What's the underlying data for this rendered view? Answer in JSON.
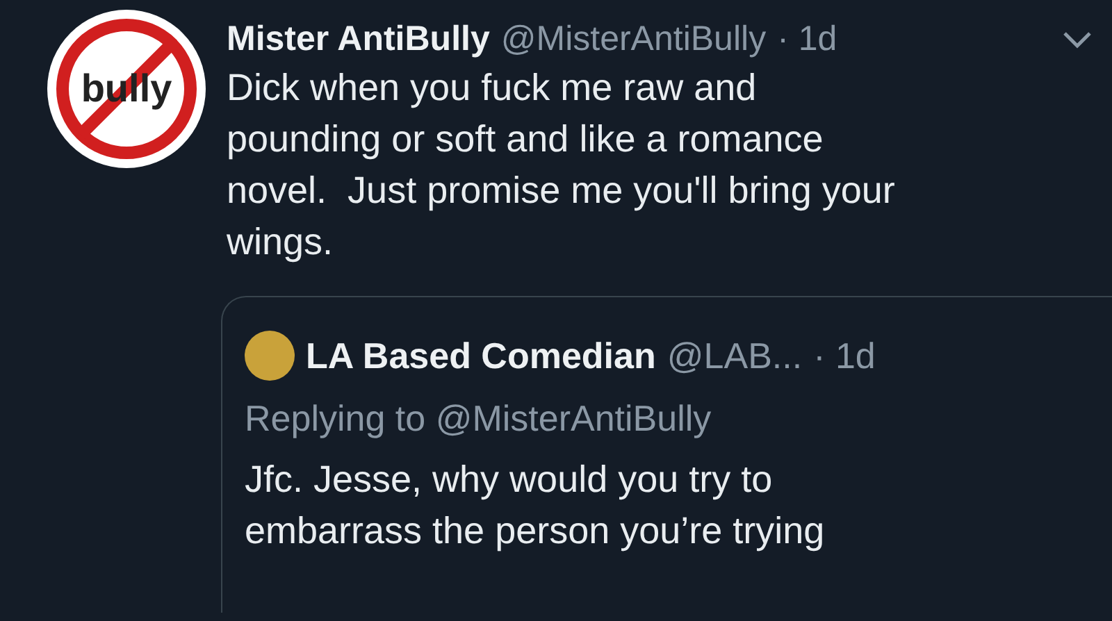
{
  "tweet": {
    "avatar_text": "bully",
    "name": "Mister AntiBully",
    "handle": "@MisterAntiBully",
    "time": "· 1d",
    "text_lines": [
      "Dick when you fuck me raw and",
      "pounding or soft and like a romance",
      "novel.  Just promise me you'll bring your",
      "wings."
    ],
    "quote": {
      "name": "LA Based Comedian",
      "handle": "@LAB...",
      "time": "· 1d",
      "replying_label": "Replying to",
      "replying_to": "@MisterAntiBully",
      "text_lines": [
        "Jfc. Jesse, why would you try to",
        "embarrass the person you’re trying"
      ]
    }
  }
}
